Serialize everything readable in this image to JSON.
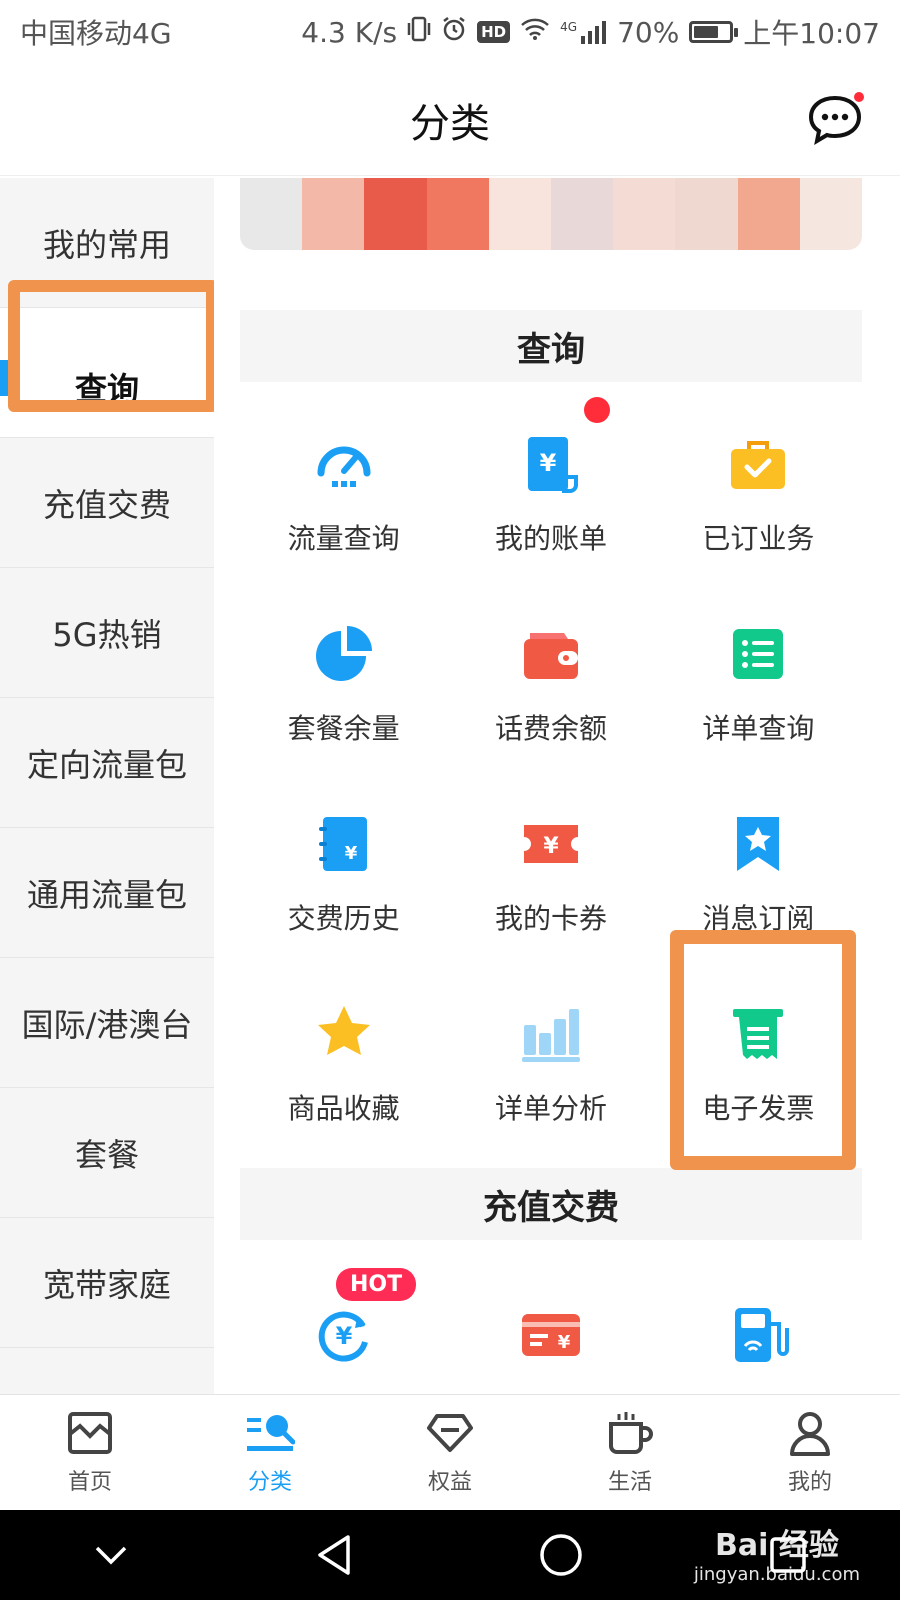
{
  "status_bar": {
    "carrier": "中国移动4G",
    "speed": "4.3 K/s",
    "hd": "HD",
    "net": "4G",
    "battery": "70%",
    "battery_level": 0.7,
    "time": "上午10:07"
  },
  "header": {
    "title": "分类"
  },
  "sidebar": {
    "items": [
      {
        "label": "我的常用"
      },
      {
        "label": "查询"
      },
      {
        "label": "充值交费"
      },
      {
        "label": "5G热销"
      },
      {
        "label": "定向流量包"
      },
      {
        "label": "通用流量包"
      },
      {
        "label": "国际/港澳台"
      },
      {
        "label": "套餐"
      },
      {
        "label": "宽带家庭"
      }
    ]
  },
  "sections": {
    "query": {
      "title": "查询",
      "items": [
        {
          "label": "流量查询",
          "icon": "speedometer-icon"
        },
        {
          "label": "我的账单",
          "icon": "bill-icon"
        },
        {
          "label": "已订业务",
          "icon": "briefcase-icon"
        },
        {
          "label": "套餐余量",
          "icon": "pie-chart-icon"
        },
        {
          "label": "话费余额",
          "icon": "wallet-icon"
        },
        {
          "label": "详单查询",
          "icon": "list-icon"
        },
        {
          "label": "交费历史",
          "icon": "notebook-icon"
        },
        {
          "label": "我的卡券",
          "icon": "coupon-icon"
        },
        {
          "label": "消息订阅",
          "icon": "bookmark-star-icon"
        },
        {
          "label": "商品收藏",
          "icon": "star-icon"
        },
        {
          "label": "详单分析",
          "icon": "bar-chart-icon"
        },
        {
          "label": "电子发票",
          "icon": "invoice-icon"
        }
      ]
    },
    "recharge": {
      "title": "充值交费",
      "hot": "HOT",
      "items": [
        {
          "icon": "recharge-yen-icon"
        },
        {
          "icon": "card-yen-icon"
        },
        {
          "icon": "fuel-wifi-icon"
        }
      ]
    }
  },
  "bottom_nav": {
    "items": [
      {
        "label": "首页",
        "icon": "home-icon"
      },
      {
        "label": "分类",
        "icon": "category-icon"
      },
      {
        "label": "权益",
        "icon": "diamond-icon"
      },
      {
        "label": "生活",
        "icon": "cup-icon"
      },
      {
        "label": "我的",
        "icon": "user-icon"
      }
    ]
  },
  "watermark": {
    "top": "Bai 经验",
    "bottom": "jingyan.baidu.com"
  },
  "colors": {
    "accent": "#1a9ff5",
    "highlight": "#f0944d",
    "badge_red": "#ff2d3a"
  }
}
